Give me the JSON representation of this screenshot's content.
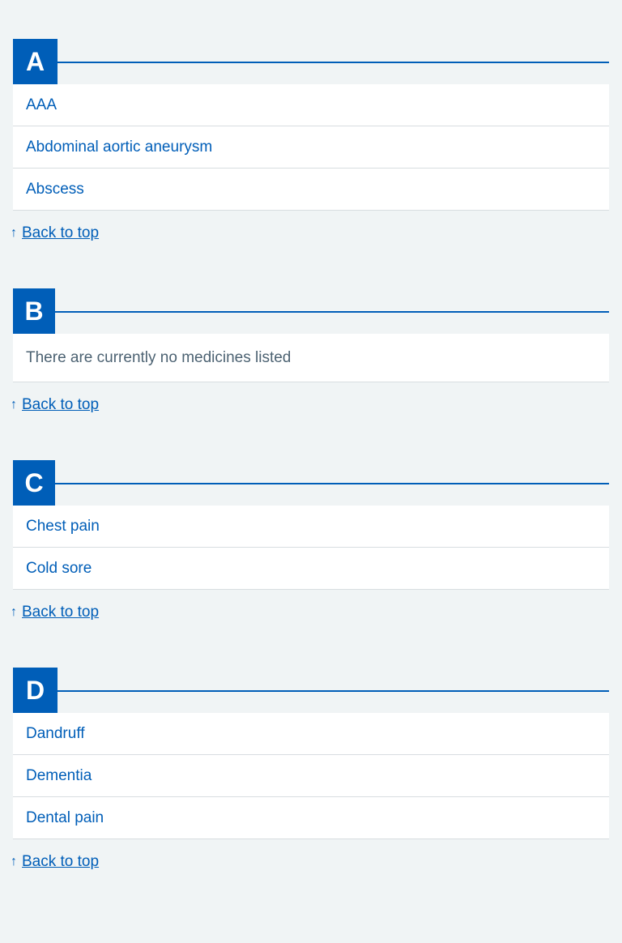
{
  "sections": [
    {
      "letter": "A",
      "items": [
        "AAA",
        "Abdominal aortic aneurysm",
        "Abscess"
      ],
      "empty_text": null
    },
    {
      "letter": "B",
      "items": [],
      "empty_text": "There are currently no medicines listed"
    },
    {
      "letter": "C",
      "items": [
        "Chest pain",
        "Cold sore"
      ],
      "empty_text": null
    },
    {
      "letter": "D",
      "items": [
        "Dandruff",
        "Dementia",
        "Dental pain"
      ],
      "empty_text": null
    }
  ],
  "back_to_top": {
    "label": "Back to top",
    "icon": "arrow-up-icon"
  },
  "colors": {
    "brand_blue": "#005eb8",
    "page_bg": "#f0f4f5",
    "panel_bg": "#ffffff",
    "divider": "#d8dde0",
    "muted_text": "#4c6272"
  }
}
